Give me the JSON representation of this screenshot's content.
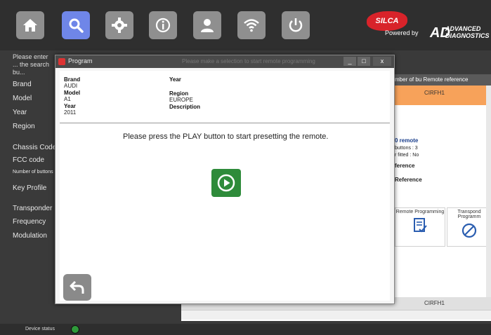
{
  "toolbar": {
    "buttons": [
      {
        "name": "home-button",
        "icon": "home-icon",
        "active": false
      },
      {
        "name": "search-button",
        "icon": "search-icon",
        "active": true
      },
      {
        "name": "settings-button",
        "icon": "gear-icon",
        "active": false
      },
      {
        "name": "info-button",
        "icon": "info-icon",
        "active": false
      },
      {
        "name": "user-button",
        "icon": "user-icon",
        "active": false
      },
      {
        "name": "wifi-button",
        "icon": "wifi-icon",
        "active": false
      },
      {
        "name": "power-button",
        "icon": "power-icon",
        "active": false
      }
    ],
    "accent_color": "#6f86e8"
  },
  "logo": {
    "brand": "SILCA",
    "powered_by": "Powered by",
    "ad": "AD",
    "advanced": "ADVANCED",
    "diagnostics": "DIAGNOSTICS"
  },
  "left_panel": {
    "hint": "Please enter ... the search bu...",
    "fields": [
      "Brand",
      "Model",
      "Year",
      "Region",
      "Chassis Code",
      "FCC code",
      "Number of buttons",
      "Key Profile",
      "Transponder ID",
      "Frequency",
      "Modulation"
    ]
  },
  "background_table": {
    "header": "mber of bu Remote reference",
    "cirf_top": "CIRFH1",
    "remote_title": "0 remote",
    "buttons_line": "buttons : 3",
    "fitted_line": "r fitted : No",
    "reference_a": "ference",
    "reference_b": "Reference",
    "col_remote": "Remote Programming",
    "col_transponder": "Transpond Programm",
    "cirf_bottom": "CIRFH1"
  },
  "modal": {
    "title": "Program",
    "ghost_title": "Please make a selection to start remote programming",
    "win_min": "_",
    "win_max": "□",
    "win_close": "x",
    "info": {
      "brand_label": "Brand",
      "brand_value": "AUDI",
      "model_label": "Model",
      "model_value": "A1",
      "year_label": "Year",
      "year_value": "2011",
      "year2_label": "Year",
      "region_label": "Region",
      "region_value": "EUROPE",
      "description_label": "Description"
    },
    "instruction": "Please press the PLAY button to start presetting the remote."
  },
  "status": {
    "label": "Device status",
    "led_color": "#2f9a3a"
  }
}
